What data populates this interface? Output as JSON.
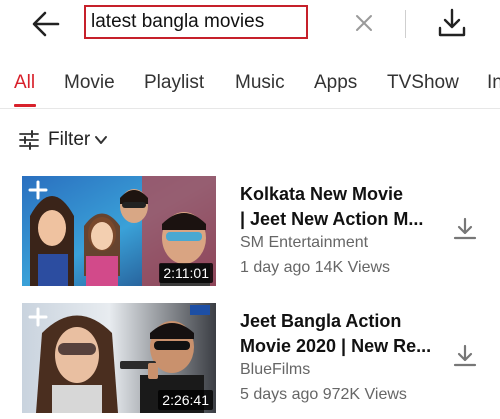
{
  "search": {
    "query": "latest bangla movies"
  },
  "tabs": [
    {
      "label": "All"
    },
    {
      "label": "Movie"
    },
    {
      "label": "Playlist"
    },
    {
      "label": "Music"
    },
    {
      "label": "Apps"
    },
    {
      "label": "TVShow"
    },
    {
      "label": "In"
    }
  ],
  "active_tab": "All",
  "filter": {
    "label": "Filter"
  },
  "results": [
    {
      "title_line1": "Kolkata New Movie",
      "title_line2": "| Jeet New Action M...",
      "channel": "SM Entertainment",
      "meta": "1 day ago 14K Views",
      "duration": "2:11:01"
    },
    {
      "title_line1": "Jeet Bangla Action",
      "title_line2": "Movie 2020 | New Re...",
      "channel": "BlueFilms",
      "meta": "5 days ago 972K Views",
      "duration": "2:26:41"
    }
  ],
  "colors": {
    "accent": "#d8212b",
    "text_secondary": "#666666"
  },
  "icons": {
    "back": "arrow-left-icon",
    "clear": "close-icon",
    "download": "download-icon",
    "filter": "sliders-icon",
    "add": "plus-icon"
  }
}
